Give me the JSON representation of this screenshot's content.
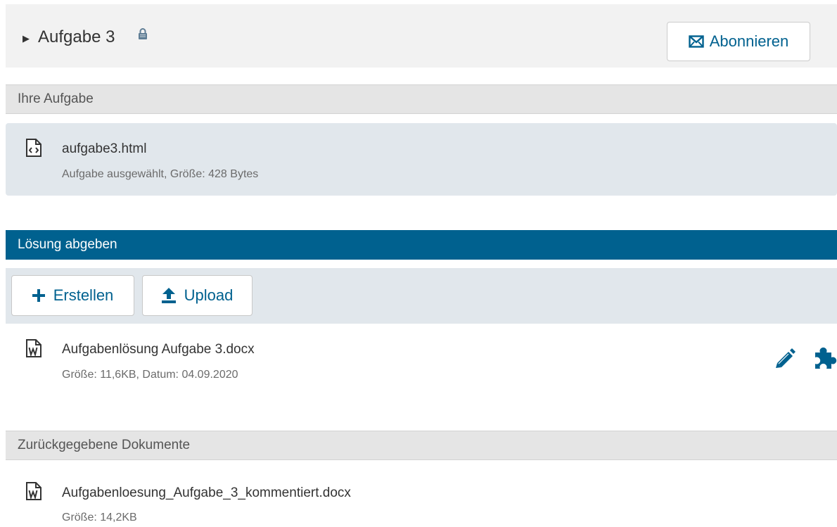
{
  "header": {
    "title": "Aufgabe 3",
    "toggle_icon": "caret-right-icon",
    "lock_icon": "lock-icon",
    "subscribe_label": "Abonnieren",
    "subscribe_icon": "envelope-icon"
  },
  "task_section": {
    "heading": "Ihre Aufgabe",
    "file": {
      "icon": "code-file-icon",
      "name": "aufgabe3.html",
      "meta": "Aufgabe ausgewählt, Größe: 428 Bytes"
    }
  },
  "submit_section": {
    "heading": "Lösung abgeben",
    "create_label": "Erstellen",
    "create_icon": "plus-icon",
    "upload_label": "Upload",
    "upload_icon": "upload-icon",
    "file": {
      "icon": "word-file-icon",
      "name": "Aufgabenlösung Aufgabe 3.docx",
      "meta": "Größe: 11,6KB, Datum: 04.09.2020",
      "edit_icon": "pencil-icon",
      "plugin_icon": "puzzle-icon"
    }
  },
  "returned_section": {
    "heading": "Zurückgegebene Dokumente",
    "file": {
      "icon": "word-file-icon",
      "name": "Aufgabenloesung_Aufgabe_3_kommentiert.docx",
      "meta": "Größe: 14,2KB"
    }
  },
  "colors": {
    "accent": "#00618f",
    "panel": "#e1e7ec",
    "section_gray": "#e5e5e5"
  }
}
